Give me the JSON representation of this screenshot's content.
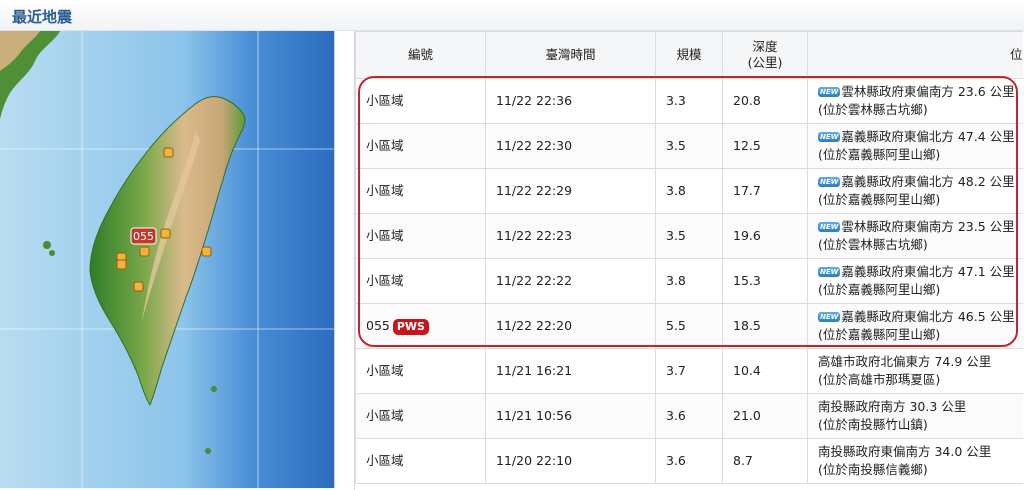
{
  "header": {
    "title": "最近地震"
  },
  "table": {
    "headers": {
      "id": "編號",
      "time": "臺灣時間",
      "magnitude": "規模",
      "depth_line1": "深度",
      "depth_line2": "(公里)",
      "location": "位置"
    },
    "rows": [
      {
        "id": "小區域",
        "pws": "",
        "time": "11/22 22:36",
        "magnitude": "3.3",
        "depth": "20.8",
        "new": "NEW",
        "location_line1": "雲林縣政府東偏南方 23.6 公里",
        "location_line2": "(位於雲林縣古坑鄉)"
      },
      {
        "id": "小區域",
        "pws": "",
        "time": "11/22 22:30",
        "magnitude": "3.5",
        "depth": "12.5",
        "new": "NEW",
        "location_line1": "嘉義縣政府東偏北方 47.4 公里",
        "location_line2": "(位於嘉義縣阿里山鄉)"
      },
      {
        "id": "小區域",
        "pws": "",
        "time": "11/22 22:29",
        "magnitude": "3.8",
        "depth": "17.7",
        "new": "NEW",
        "location_line1": "嘉義縣政府東偏北方 48.2 公里",
        "location_line2": "(位於嘉義縣阿里山鄉)"
      },
      {
        "id": "小區域",
        "pws": "",
        "time": "11/22 22:23",
        "magnitude": "3.5",
        "depth": "19.6",
        "new": "NEW",
        "location_line1": "雲林縣政府東偏南方 23.5 公里",
        "location_line2": "(位於雲林縣古坑鄉)"
      },
      {
        "id": "小區域",
        "pws": "",
        "time": "11/22 22:22",
        "magnitude": "3.8",
        "depth": "15.3",
        "new": "NEW",
        "location_line1": "嘉義縣政府東偏北方 47.1 公里",
        "location_line2": "(位於嘉義縣阿里山鄉)"
      },
      {
        "id": "055",
        "pws": "PWS",
        "time": "11/22 22:20",
        "magnitude": "5.5",
        "depth": "18.5",
        "new": "NEW",
        "location_line1": "嘉義縣政府東偏北方 46.5 公里",
        "location_line2": "(位於嘉義縣阿里山鄉)"
      },
      {
        "id": "小區域",
        "pws": "",
        "time": "11/21 16:21",
        "magnitude": "3.7",
        "depth": "10.4",
        "new": "",
        "location_line1": "高雄市政府北偏東方 74.9 公里",
        "location_line2": "(位於高雄市那瑪夏區)"
      },
      {
        "id": "小區域",
        "pws": "",
        "time": "11/21 10:56",
        "magnitude": "3.6",
        "depth": "21.0",
        "new": "",
        "location_line1": "南投縣政府南方 30.3 公里",
        "location_line2": "(位於南投縣竹山鎮)"
      },
      {
        "id": "小區域",
        "pws": "",
        "time": "11/20 22:10",
        "magnitude": "3.6",
        "depth": "8.7",
        "new": "",
        "location_line1": "南投縣政府東偏南方 34.0 公里",
        "location_line2": "(位於南投縣信義鄉)"
      }
    ]
  },
  "map": {
    "marker_label": "055",
    "colors": {
      "sea_deep": "#2f72c4",
      "sea_shallow": "#cfe6f5",
      "land_low": "#3d8a2e",
      "land_high": "#d8b98a",
      "marker": "#c0392b"
    }
  }
}
